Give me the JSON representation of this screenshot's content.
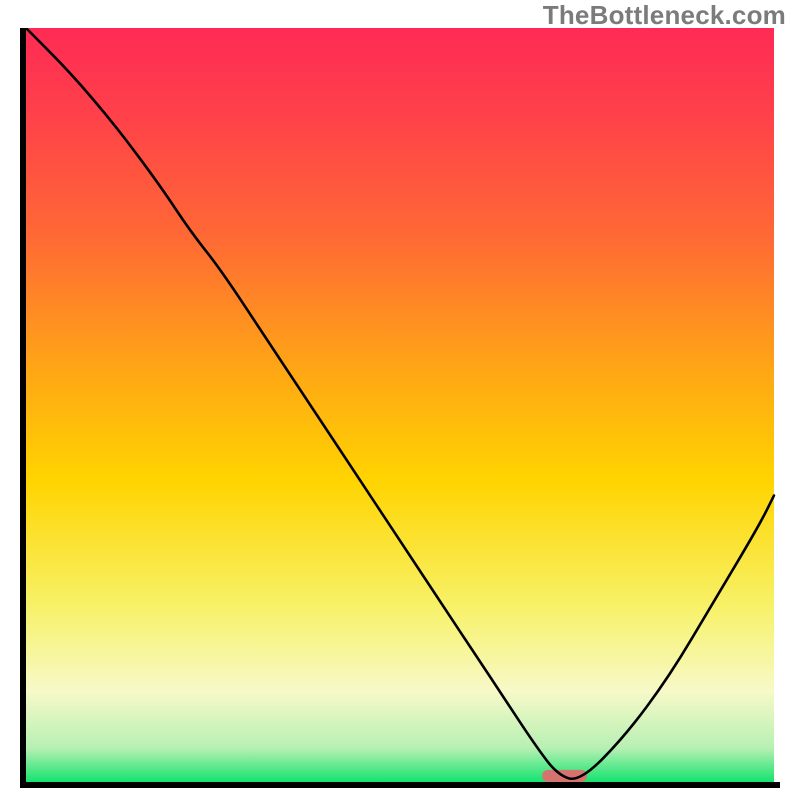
{
  "watermark": "TheBottleneck.com",
  "chart_data": {
    "type": "line",
    "title": "",
    "xlabel": "",
    "ylabel": "",
    "xlim": [
      0,
      100
    ],
    "ylim": [
      0,
      100
    ],
    "grid": false,
    "legend": false,
    "background_gradient_stops": [
      {
        "offset": 0.0,
        "color": "#ff2a55"
      },
      {
        "offset": 0.12,
        "color": "#ff4249"
      },
      {
        "offset": 0.28,
        "color": "#ff6a34"
      },
      {
        "offset": 0.45,
        "color": "#ffa516"
      },
      {
        "offset": 0.6,
        "color": "#ffd400"
      },
      {
        "offset": 0.77,
        "color": "#f7f26a"
      },
      {
        "offset": 0.88,
        "color": "#f7f9c8"
      },
      {
        "offset": 0.955,
        "color": "#b7f0b3"
      },
      {
        "offset": 1.0,
        "color": "#14e36e"
      }
    ],
    "series": [
      {
        "name": "bottleneck-curve",
        "color": "#000000",
        "x": [
          0,
          6,
          12,
          18,
          22,
          26,
          32,
          38,
          44,
          50,
          56,
          60,
          64,
          68,
          71,
          74,
          80,
          86,
          92,
          98,
          100
        ],
        "y": [
          100,
          94,
          87,
          79,
          73,
          68,
          59,
          50,
          41,
          32,
          23,
          17,
          11,
          5,
          1,
          0,
          6,
          14,
          24,
          34,
          38
        ]
      }
    ],
    "marker": {
      "name": "optimal-zone",
      "color": "#d6736f",
      "x_start": 69,
      "x_end": 75,
      "y": 0,
      "height_pct": 1.6
    }
  }
}
